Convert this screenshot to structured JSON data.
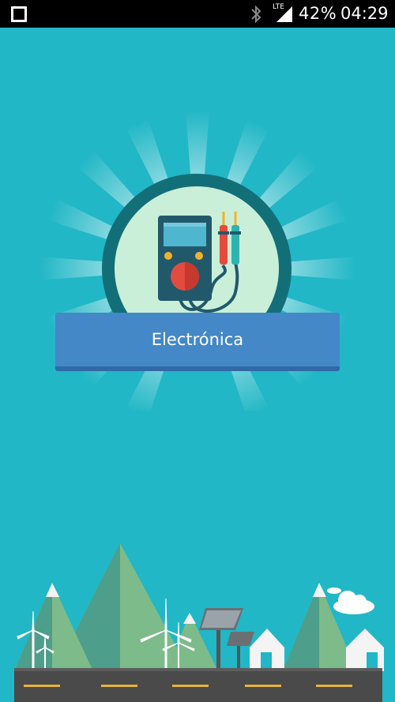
{
  "status_bar": {
    "battery": "42%",
    "network": "LTE",
    "time": "04:29"
  },
  "main": {
    "category_button_label": "Electrónica"
  },
  "icons": {
    "status_left": "square-outline-icon",
    "bluetooth": "bluetooth-icon",
    "signal": "signal-icon",
    "hero": "multimeter-icon"
  },
  "colors": {
    "background": "#21b7c6",
    "button": "#4488c7",
    "button_shadow": "#2f6aa6",
    "circle_ring": "#126f78",
    "circle_fill": "#c9efd9"
  }
}
